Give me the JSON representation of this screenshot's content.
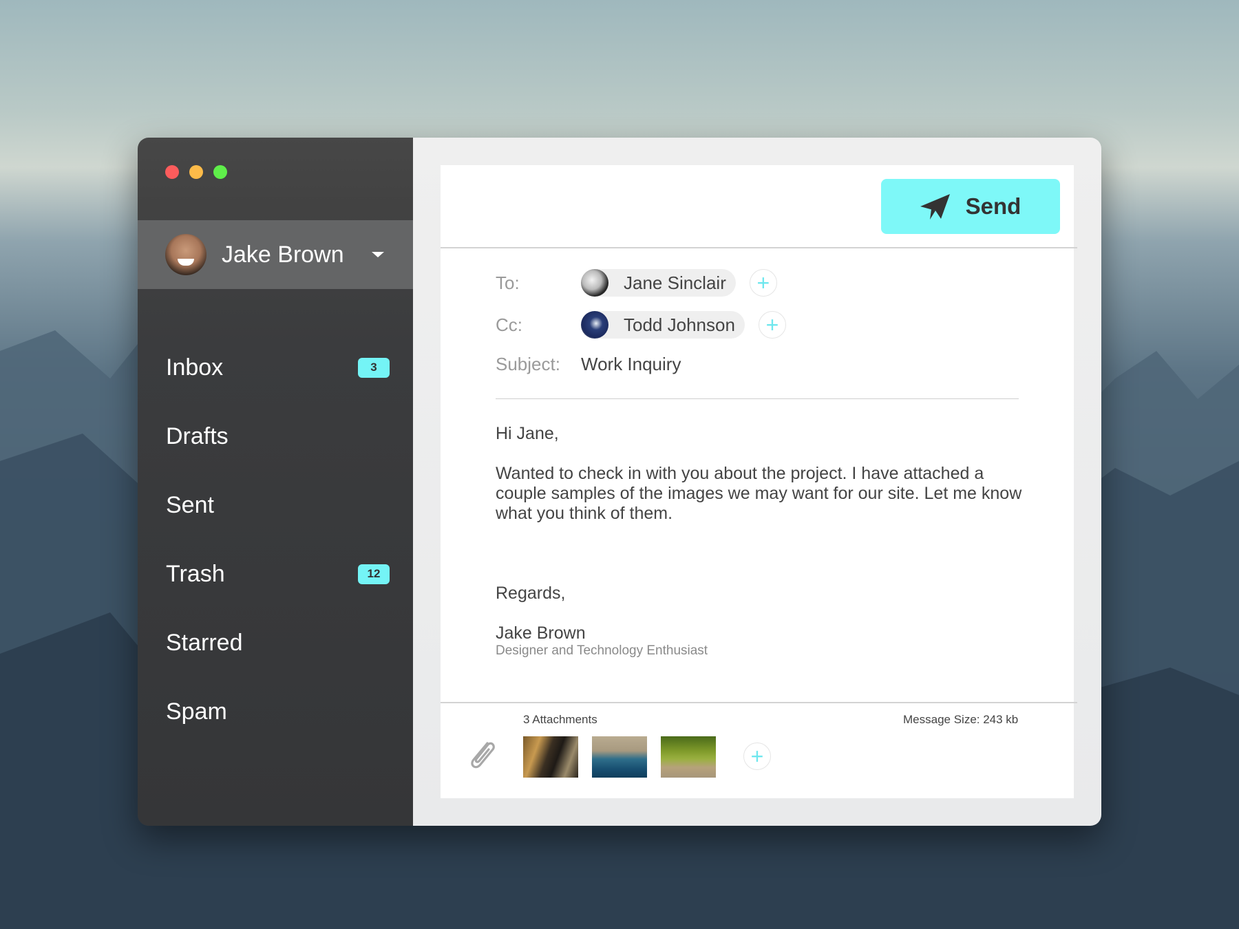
{
  "window": {
    "traffic_lights": [
      "close",
      "minimize",
      "maximize"
    ]
  },
  "account": {
    "name": "Jake Brown",
    "avatar_icon": "user-avatar",
    "menu_icon": "chevron-down-icon"
  },
  "sidebar": {
    "items": [
      {
        "label": "Inbox",
        "badge": "3"
      },
      {
        "label": "Drafts",
        "badge": null
      },
      {
        "label": "Sent",
        "badge": null
      },
      {
        "label": "Trash",
        "badge": "12"
      },
      {
        "label": "Starred",
        "badge": null
      },
      {
        "label": "Spam",
        "badge": null
      }
    ]
  },
  "compose": {
    "send_label": "Send",
    "send_icon": "paper-plane-icon",
    "to_label": "To:",
    "to_recipient": "Jane Sinclair",
    "cc_label": "Cc:",
    "cc_recipient": "Todd Johnson",
    "subject_label": "Subject:",
    "subject_value": "Work Inquiry",
    "add_icon": "+",
    "body": {
      "greeting": "Hi Jane,",
      "paragraph": "Wanted to check in with you about the project. I have attached a couple samples of the images we may want for our site. Let me know what you think of them.",
      "closing": "Regards,",
      "signature_name": "Jake Brown",
      "signature_title": "Designer and Technology Enthusiast"
    }
  },
  "attachments": {
    "count_label": "3 Attachments",
    "message_size_label": "Message Size: 243 kb",
    "items": [
      "hallway-photo",
      "coastline-aerial-photo",
      "forest-moss-photo"
    ],
    "add_icon": "+"
  },
  "colors": {
    "accent": "#7ef8f8",
    "sidebar_bg": "#3b3c3e",
    "account_bg": "#646566",
    "badge": "#74f4f6"
  }
}
